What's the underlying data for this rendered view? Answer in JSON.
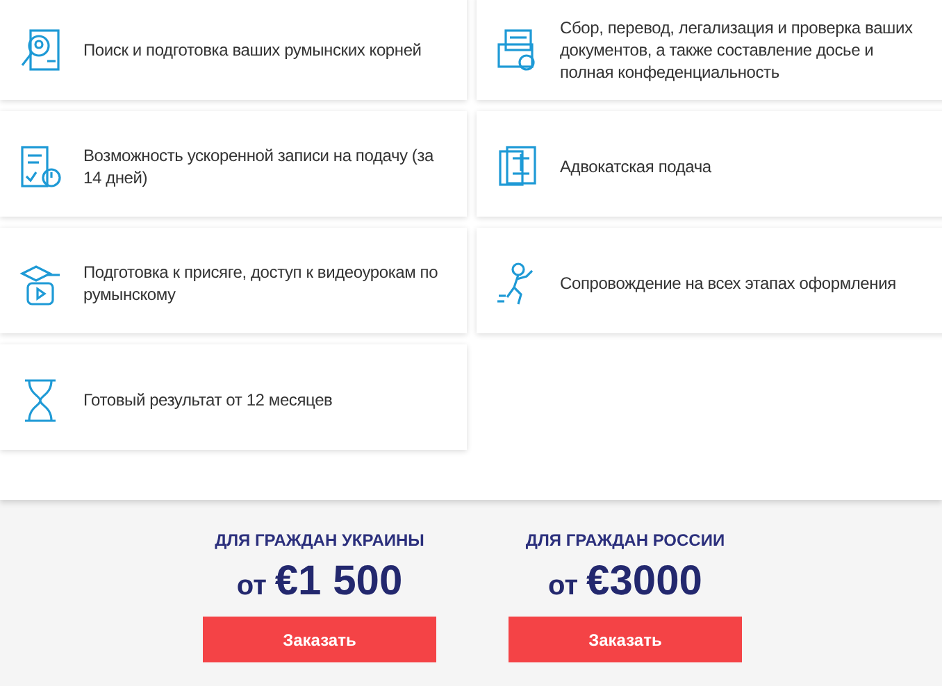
{
  "features": [
    {
      "text": "Поиск и подготовка ваших румынских корней"
    },
    {
      "text": "Сбор, перевод, легализация и проверка ваших документов, а также составление досье и полная конфеденциальность"
    },
    {
      "text": "Возможность ускоренной записи на подачу (за 14 дней)"
    },
    {
      "text": "Адвокатская подача"
    },
    {
      "text": "Подготовка к присяге, доступ к видеоурокам по румынскому"
    },
    {
      "text": "Сопровождение на всех этапах оформления"
    },
    {
      "text": "Готовый результат от 12 месяцев"
    }
  ],
  "offers": [
    {
      "heading": "ДЛЯ ГРАЖДАН УКРАИНЫ",
      "prefix": "от",
      "price": "€1 500",
      "button": "Заказать"
    },
    {
      "heading": "ДЛЯ ГРАЖДАН РОССИИ",
      "prefix": "от",
      "price": "€3000",
      "button": "Заказать"
    }
  ]
}
